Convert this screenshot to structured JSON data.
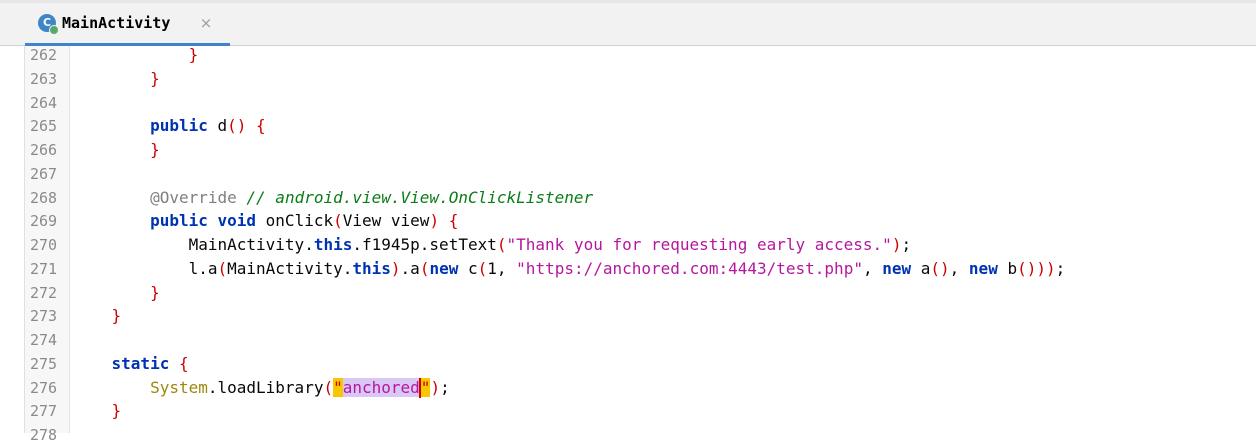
{
  "tab": {
    "icon_letter": "C",
    "title": "MainActivity",
    "close_glyph": "×"
  },
  "colors": {
    "tab_underline": "#4083c9",
    "keyword": "#0033b3",
    "brace": "#cc0000",
    "string": "#b5179e",
    "comment": "#0a7d15",
    "annotation": "#808080",
    "highlight": "#d9c8f5"
  },
  "lines": [
    {
      "num": "262",
      "tokens": [
        {
          "t": "            ",
          "c": "plain"
        },
        {
          "t": "}",
          "c": "br"
        }
      ]
    },
    {
      "num": "263",
      "tokens": [
        {
          "t": "        ",
          "c": "plain"
        },
        {
          "t": "}",
          "c": "br"
        }
      ]
    },
    {
      "num": "264",
      "tokens": []
    },
    {
      "num": "265",
      "tokens": [
        {
          "t": "        ",
          "c": "plain"
        },
        {
          "t": "public",
          "c": "kw"
        },
        {
          "t": " d",
          "c": "plain"
        },
        {
          "t": "()",
          "c": "br"
        },
        {
          "t": " ",
          "c": "plain"
        },
        {
          "t": "{",
          "c": "br"
        }
      ]
    },
    {
      "num": "266",
      "tokens": [
        {
          "t": "        ",
          "c": "plain"
        },
        {
          "t": "}",
          "c": "br"
        }
      ]
    },
    {
      "num": "267",
      "tokens": []
    },
    {
      "num": "268",
      "tokens": [
        {
          "t": "        ",
          "c": "plain"
        },
        {
          "t": "@Override",
          "c": "ann"
        },
        {
          "t": " ",
          "c": "plain"
        },
        {
          "t": "// android.view.View.OnClickListener",
          "c": "cmt"
        }
      ]
    },
    {
      "num": "269",
      "tokens": [
        {
          "t": "        ",
          "c": "plain"
        },
        {
          "t": "public",
          "c": "kw"
        },
        {
          "t": " ",
          "c": "plain"
        },
        {
          "t": "void",
          "c": "kw"
        },
        {
          "t": " onClick",
          "c": "plain"
        },
        {
          "t": "(",
          "c": "br"
        },
        {
          "t": "View view",
          "c": "plain"
        },
        {
          "t": ")",
          "c": "br"
        },
        {
          "t": " ",
          "c": "plain"
        },
        {
          "t": "{",
          "c": "br"
        }
      ]
    },
    {
      "num": "270",
      "tokens": [
        {
          "t": "            MainActivity.",
          "c": "plain"
        },
        {
          "t": "this",
          "c": "kw"
        },
        {
          "t": ".f1945p.setText",
          "c": "plain"
        },
        {
          "t": "(",
          "c": "br"
        },
        {
          "t": "\"Thank you for requesting early access.\"",
          "c": "str"
        },
        {
          "t": ")",
          "c": "br"
        },
        {
          "t": ";",
          "c": "plain"
        }
      ]
    },
    {
      "num": "271",
      "tokens": [
        {
          "t": "            l.a",
          "c": "plain"
        },
        {
          "t": "(",
          "c": "br"
        },
        {
          "t": "MainActivity.",
          "c": "plain"
        },
        {
          "t": "this",
          "c": "kw"
        },
        {
          "t": ")",
          "c": "br"
        },
        {
          "t": ".a",
          "c": "plain"
        },
        {
          "t": "(",
          "c": "br"
        },
        {
          "t": "new",
          "c": "kw"
        },
        {
          "t": " c",
          "c": "plain"
        },
        {
          "t": "(",
          "c": "br"
        },
        {
          "t": "1, ",
          "c": "plain"
        },
        {
          "t": "\"https://anchored.com:4443/test.php\"",
          "c": "str"
        },
        {
          "t": ", ",
          "c": "plain"
        },
        {
          "t": "new",
          "c": "kw"
        },
        {
          "t": " a",
          "c": "plain"
        },
        {
          "t": "()",
          "c": "br"
        },
        {
          "t": ", ",
          "c": "plain"
        },
        {
          "t": "new",
          "c": "kw"
        },
        {
          "t": " b",
          "c": "plain"
        },
        {
          "t": "()))",
          "c": "br"
        },
        {
          "t": ";",
          "c": "plain"
        }
      ]
    },
    {
      "num": "272",
      "tokens": [
        {
          "t": "        ",
          "c": "plain"
        },
        {
          "t": "}",
          "c": "br"
        }
      ]
    },
    {
      "num": "273",
      "tokens": [
        {
          "t": "    ",
          "c": "plain"
        },
        {
          "t": "}",
          "c": "br"
        }
      ]
    },
    {
      "num": "274",
      "tokens": []
    },
    {
      "num": "275",
      "tokens": [
        {
          "t": "    ",
          "c": "plain"
        },
        {
          "t": "static",
          "c": "kw"
        },
        {
          "t": " ",
          "c": "plain"
        },
        {
          "t": "{",
          "c": "br"
        }
      ]
    },
    {
      "num": "276",
      "tokens": [
        {
          "t": "        ",
          "c": "plain"
        },
        {
          "t": "System",
          "c": "cls"
        },
        {
          "t": ".loadLibrary",
          "c": "plain"
        },
        {
          "t": "(",
          "c": "br"
        },
        {
          "t": "\"",
          "c": "hl-q"
        },
        {
          "t": "anchored",
          "c": "hl-str"
        },
        {
          "t": "\"",
          "c": "hl-q"
        },
        {
          "t": ")",
          "c": "br"
        },
        {
          "t": ";",
          "c": "plain"
        }
      ]
    },
    {
      "num": "277",
      "tokens": [
        {
          "t": "    ",
          "c": "plain"
        },
        {
          "t": "}",
          "c": "br"
        }
      ]
    },
    {
      "num": "278",
      "tokens": []
    }
  ]
}
